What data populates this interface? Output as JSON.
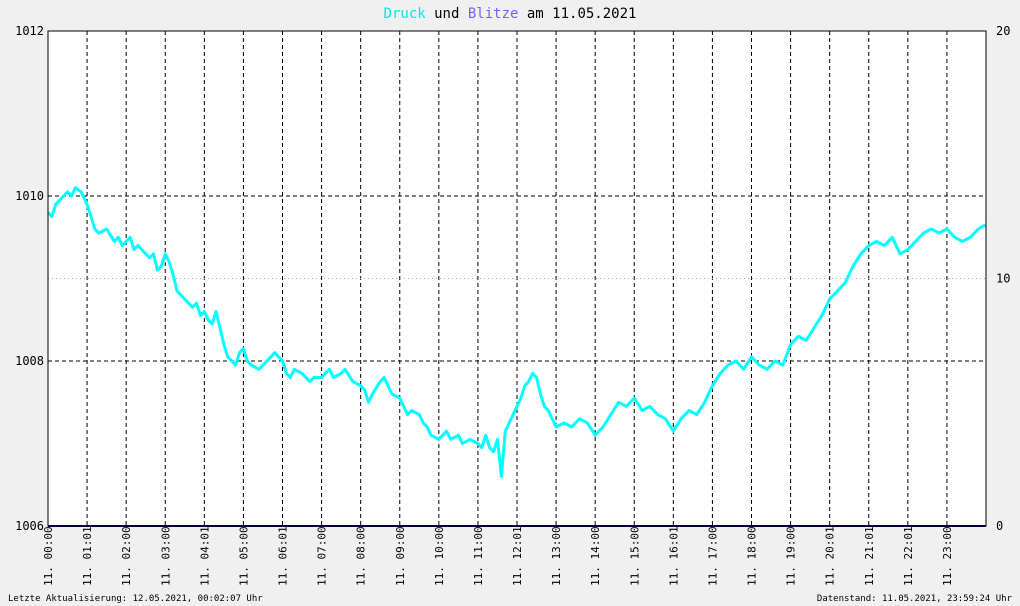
{
  "title": {
    "part1": "Druck",
    "part2": " und ",
    "part3": "Blitze",
    "part4": " am 11.05.2021",
    "color1": "#00e8e8",
    "color3": "#7a5cff"
  },
  "footer": {
    "left": "Letzte Aktualisierung: 12.05.2021, 00:02:07 Uhr",
    "right": "Datenstand: 11.05.2021, 23:59:24 Uhr"
  },
  "colors": {
    "pressure": "#00ffff",
    "lightning": "#000080",
    "grid": "#000000",
    "background": "#ffffff"
  },
  "chart_data": {
    "type": "line",
    "x_unit": "hours",
    "xlim": [
      0,
      24
    ],
    "ylim": [
      1006,
      1012
    ],
    "y2lim": [
      0,
      20
    ],
    "y_ticks": [
      "1006",
      "1008",
      "1010",
      "1012"
    ],
    "y2_ticks": [
      "0",
      "10",
      "20"
    ],
    "x_ticks": [
      {
        "h": 0.0,
        "label": "11. 00:00"
      },
      {
        "h": 1.0,
        "label": "11. 01:01"
      },
      {
        "h": 2.0,
        "label": "11. 02:00"
      },
      {
        "h": 3.0,
        "label": "11. 03:00"
      },
      {
        "h": 4.0,
        "label": "11. 04:01"
      },
      {
        "h": 5.0,
        "label": "11. 05:00"
      },
      {
        "h": 6.0,
        "label": "11. 06:01"
      },
      {
        "h": 7.0,
        "label": "11. 07:00"
      },
      {
        "h": 8.0,
        "label": "11. 08:00"
      },
      {
        "h": 9.0,
        "label": "11. 09:00"
      },
      {
        "h": 10.0,
        "label": "11. 10:00"
      },
      {
        "h": 11.0,
        "label": "11. 11:00"
      },
      {
        "h": 12.0,
        "label": "11. 12:01"
      },
      {
        "h": 13.0,
        "label": "11. 13:00"
      },
      {
        "h": 14.0,
        "label": "11. 14:00"
      },
      {
        "h": 15.0,
        "label": "11. 15:00"
      },
      {
        "h": 16.0,
        "label": "11. 16:01"
      },
      {
        "h": 17.0,
        "label": "11. 17:00"
      },
      {
        "h": 18.0,
        "label": "11. 18:00"
      },
      {
        "h": 19.0,
        "label": "11. 19:00"
      },
      {
        "h": 20.0,
        "label": "11. 20:01"
      },
      {
        "h": 21.0,
        "label": "11. 21:01"
      },
      {
        "h": 22.0,
        "label": "11. 22:01"
      },
      {
        "h": 23.0,
        "label": "11. 23:00"
      }
    ],
    "y_grid": [
      1008,
      1010,
      1012
    ],
    "y_grid_dotted": [
      1009
    ],
    "series": [
      {
        "axis": "left",
        "x": [
          0,
          0.1,
          0.2,
          0.3,
          0.5,
          0.6,
          0.7,
          0.85,
          1.0,
          1.1,
          1.2,
          1.3,
          1.5,
          1.7,
          1.8,
          1.9,
          2.0,
          2.1,
          2.2,
          2.3,
          2.5,
          2.6,
          2.7,
          2.8,
          2.9,
          3.0,
          3.1,
          3.2,
          3.3,
          3.5,
          3.6,
          3.7,
          3.8,
          3.9,
          4.0,
          4.1,
          4.2,
          4.3,
          4.5,
          4.6,
          4.8,
          4.9,
          5.0,
          5.1,
          5.2,
          5.4,
          5.5,
          5.7,
          5.8,
          6.0,
          6.1,
          6.2,
          6.3,
          6.5,
          6.7,
          6.8,
          7.0,
          7.1,
          7.2,
          7.3,
          7.5,
          7.6,
          7.8,
          8.0,
          8.1,
          8.2,
          8.3,
          8.5,
          8.6,
          8.8,
          9.0,
          9.1,
          9.2,
          9.3,
          9.5,
          9.6,
          9.7,
          9.8,
          10.0,
          10.1,
          10.2,
          10.3,
          10.5,
          10.6,
          10.8,
          11.0,
          11.1,
          11.2,
          11.3,
          11.4,
          11.5,
          11.6,
          11.7,
          11.8,
          12.0,
          12.1,
          12.2,
          12.3,
          12.4,
          12.5,
          12.6,
          12.7,
          12.8,
          13.0,
          13.2,
          13.4,
          13.6,
          13.8,
          14.0,
          14.2,
          14.4,
          14.6,
          14.8,
          15.0,
          15.2,
          15.4,
          15.6,
          15.8,
          16.0,
          16.2,
          16.4,
          16.6,
          16.8,
          17.0,
          17.2,
          17.4,
          17.6,
          17.8,
          18.0,
          18.2,
          18.4,
          18.6,
          18.8,
          19.0,
          19.2,
          19.4,
          19.6,
          19.8,
          20.0,
          20.2,
          20.4,
          20.6,
          20.8,
          21.0,
          21.2,
          21.4,
          21.6,
          21.8,
          22.0,
          22.2,
          22.4,
          22.6,
          22.8,
          23.0,
          23.2,
          23.4,
          23.6,
          23.8,
          23.98
        ],
        "values": [
          1009.8,
          1009.75,
          1009.9,
          1009.95,
          1010.05,
          1010.0,
          1010.1,
          1010.05,
          1009.9,
          1009.75,
          1009.6,
          1009.55,
          1009.6,
          1009.45,
          1009.5,
          1009.4,
          1009.45,
          1009.5,
          1009.35,
          1009.4,
          1009.3,
          1009.25,
          1009.3,
          1009.1,
          1009.15,
          1009.3,
          1009.2,
          1009.05,
          1008.85,
          1008.75,
          1008.7,
          1008.65,
          1008.7,
          1008.55,
          1008.6,
          1008.5,
          1008.45,
          1008.6,
          1008.2,
          1008.05,
          1007.95,
          1008.1,
          1008.15,
          1008.0,
          1007.95,
          1007.9,
          1007.95,
          1008.05,
          1008.1,
          1008.0,
          1007.85,
          1007.8,
          1007.9,
          1007.85,
          1007.75,
          1007.8,
          1007.8,
          1007.85,
          1007.9,
          1007.8,
          1007.85,
          1007.9,
          1007.75,
          1007.7,
          1007.65,
          1007.5,
          1007.6,
          1007.75,
          1007.8,
          1007.6,
          1007.55,
          1007.45,
          1007.35,
          1007.4,
          1007.35,
          1007.25,
          1007.2,
          1007.1,
          1007.05,
          1007.1,
          1007.15,
          1007.05,
          1007.1,
          1007.0,
          1007.05,
          1007.0,
          1006.95,
          1007.1,
          1006.95,
          1006.9,
          1007.05,
          1006.6,
          1007.15,
          1007.25,
          1007.45,
          1007.55,
          1007.7,
          1007.75,
          1007.85,
          1007.8,
          1007.6,
          1007.45,
          1007.4,
          1007.2,
          1007.25,
          1007.2,
          1007.3,
          1007.25,
          1007.1,
          1007.2,
          1007.35,
          1007.5,
          1007.45,
          1007.55,
          1007.4,
          1007.45,
          1007.35,
          1007.3,
          1007.15,
          1007.3,
          1007.4,
          1007.35,
          1007.5,
          1007.7,
          1007.85,
          1007.95,
          1008.0,
          1007.9,
          1008.05,
          1007.95,
          1007.9,
          1008.0,
          1007.95,
          1008.2,
          1008.3,
          1008.25,
          1008.4,
          1008.55,
          1008.75,
          1008.85,
          1008.95,
          1009.15,
          1009.3,
          1009.4,
          1009.45,
          1009.4,
          1009.5,
          1009.3,
          1009.35,
          1009.45,
          1009.55,
          1009.6,
          1009.55,
          1009.6,
          1009.5,
          1009.45,
          1009.5,
          1009.6,
          1009.65
        ]
      },
      {
        "axis": "right",
        "x": [
          0,
          24
        ],
        "values": [
          0,
          0
        ]
      }
    ]
  }
}
